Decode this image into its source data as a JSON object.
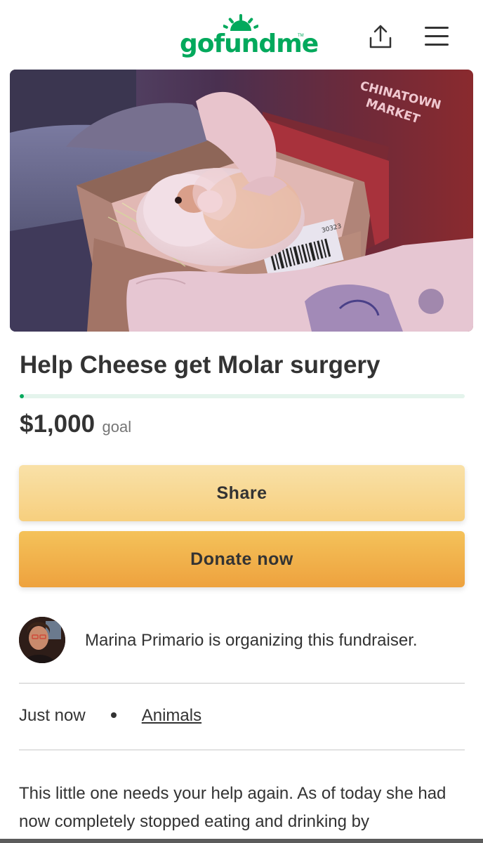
{
  "header": {
    "logo_text": "gofundme",
    "logo_tm": "TM",
    "share_icon": "share-upload-icon",
    "menu_icon": "hamburger-menu-icon"
  },
  "hero": {
    "image": "guinea pig in cardboard box held by tattooed hands",
    "box_text": "CHINATOWN MARKET",
    "barcode_text": "30323"
  },
  "campaign": {
    "title": "Help Cheese get Molar surgery",
    "progress_fraction": 0.005,
    "amount": "$1,000",
    "goal_label": "goal"
  },
  "buttons": {
    "share_label": "Share",
    "donate_label": "Donate now"
  },
  "organizer": {
    "text": "Marina Primario is organizing this fundraiser."
  },
  "meta": {
    "time": "Just now",
    "category": "Animals"
  },
  "story": {
    "text": "This little one needs your help again. As of today she had now completely stopped eating and drinking by"
  },
  "colors": {
    "brand_green": "#02a95c",
    "share_button": "#f8d896",
    "donate_button": "#f1b24a"
  }
}
